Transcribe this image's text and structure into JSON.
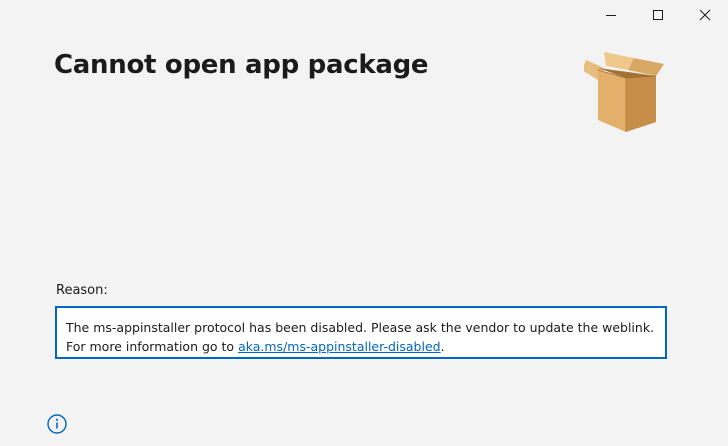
{
  "window": {
    "controls": {
      "minimize_icon": "minimize-icon",
      "maximize_icon": "maximize-icon",
      "close_icon": "close-icon"
    }
  },
  "header": {
    "title": "Cannot open app package",
    "package_icon": "cardboard-box-icon"
  },
  "reason": {
    "label": "Reason:",
    "line1": "The ms-appinstaller protocol has been disabled. Please ask the vendor to update the weblink.",
    "line2_prefix": "For more information go to ",
    "link_text": "aka.ms/ms-appinstaller-disabled",
    "line2_suffix": "."
  },
  "footer": {
    "info_icon": "info-icon"
  },
  "colors": {
    "background": "#f3f3f3",
    "accent": "#0067c0",
    "text": "#1b1b1b"
  }
}
